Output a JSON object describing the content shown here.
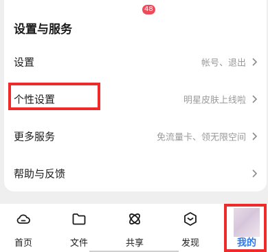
{
  "section": {
    "title": "设置与服务"
  },
  "rows": [
    {
      "label": "设置",
      "hint": "帐号、退出"
    },
    {
      "label": "个性设置",
      "hint": "明星皮肤上线啦"
    },
    {
      "label": "更多服务",
      "hint": "免流量卡、领无限空间"
    },
    {
      "label": "帮助与反馈",
      "hint": ""
    }
  ],
  "tabs": [
    {
      "label": "首页",
      "icon": "cloud-icon"
    },
    {
      "label": "文件",
      "icon": "folder-icon"
    },
    {
      "label": "共享",
      "icon": "share-atom-icon",
      "badge": "48"
    },
    {
      "label": "发现",
      "icon": "discover-cube-icon"
    },
    {
      "label": "我的",
      "icon": "avatar-image",
      "selected": true
    }
  ],
  "colors": {
    "highlight": "#ee2a2a",
    "active_tab": "#2b78f5",
    "badge": "#ef4a5a"
  }
}
